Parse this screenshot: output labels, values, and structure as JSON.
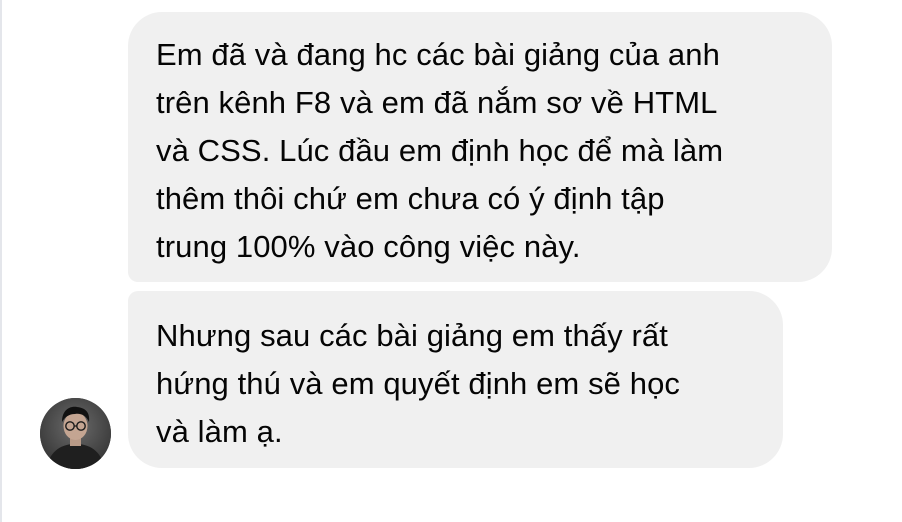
{
  "conversation": {
    "messages": [
      {
        "text": "Em đã và đang hc các bài giảng của anh\ntrên kênh F8 và em đã nắm sơ về HTML\nvà CSS. Lúc đầu em định học để mà làm\nthêm thôi chứ em chưa có ý định tập\ntrung 100% vào công việc này."
      },
      {
        "text": "Nhưng sau các bài giảng em thấy rất\nhứng thú và em quyết định em sẽ học\nvà làm ạ."
      }
    ],
    "sender_avatar": "user-avatar-photo"
  },
  "colors": {
    "bubble_background": "#f0f0f0",
    "text": "#050505",
    "page_background": "#ffffff"
  }
}
